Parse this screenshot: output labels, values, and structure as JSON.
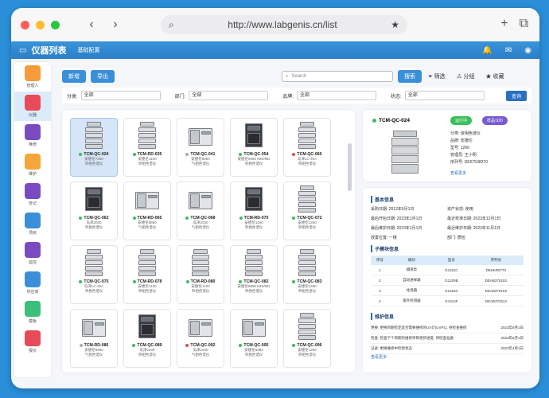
{
  "browser": {
    "url": "http://www.labgenis.cn/list"
  },
  "app": {
    "title": "仪器列表",
    "subtitle": "基础配置"
  },
  "sidebar": [
    {
      "label": "管理人",
      "color": "#f59b3a"
    },
    {
      "label": "仪器",
      "color": "#e84a5a"
    },
    {
      "label": "维修",
      "color": "#7a4bbf"
    },
    {
      "label": "维护",
      "color": "#f5a53a"
    },
    {
      "label": "管记",
      "color": "#7a4bbf"
    },
    {
      "label": "项目",
      "color": "#3b8fd8"
    },
    {
      "label": "监控",
      "color": "#7a4bbf"
    },
    {
      "label": "供应商",
      "color": "#3b8fd8"
    },
    {
      "label": "模板",
      "color": "#3bbf7a"
    },
    {
      "label": "报价",
      "color": "#e84a5a"
    }
  ],
  "toolbar": {
    "new": "新增",
    "export": "导出",
    "search_placeholder": "Search",
    "search": "搜索",
    "filter": "筛选",
    "group": "分组",
    "favorite": "收藏"
  },
  "filters": [
    {
      "label": "分类:",
      "value": "全部"
    },
    {
      "label": "部门:",
      "value": "全部"
    },
    {
      "label": "品牌:",
      "value": "全部"
    },
    {
      "label": "状态:",
      "value": "全部"
    }
  ],
  "filters_query": "查询",
  "cards": [
    {
      "id": "TCM-QC-024",
      "l1": "安捷伦7260",
      "l2": "单相色谱仪",
      "status": "#3bbf5a",
      "type": "hplc"
    },
    {
      "id": "TCM-RD-035",
      "l1": "安捷伦1100",
      "l2": "单相色谱仪",
      "status": "#3bbf5a",
      "type": "hplc"
    },
    {
      "id": "TCM-QC-041",
      "l1": "安捷伦8860",
      "l2": "气相色谱仪",
      "status": "#aaaaaa",
      "type": "gc"
    },
    {
      "id": "TCM-QC-054",
      "l1": "安捷伦6890 IMS/MD",
      "l2": "单相色谱仪",
      "status": "#3bbf5a",
      "type": "dark"
    },
    {
      "id": "TCM-QC-060",
      "l1": "岛津LC-20A",
      "l2": "单相色谱仪",
      "status": "#e84a4a",
      "type": "hplc"
    },
    {
      "id": "TCM-QC-062",
      "l1": "岛津2030",
      "l2": "单相色谱仪",
      "status": "#3bbf5a",
      "type": "dark"
    },
    {
      "id": "TCM-RD-065",
      "l1": "安捷伦8860",
      "l2": "气相色谱仪",
      "status": "#3bbf5a",
      "type": "gc"
    },
    {
      "id": "TCM-QC-068",
      "l1": "岛津2030",
      "l2": "气相色谱仪",
      "status": "#3bbf5a",
      "type": "gc"
    },
    {
      "id": "TCM-RD-070",
      "l1": "安捷伦1100",
      "l2": "单相色谱仪",
      "status": "#3bbf5a",
      "type": "dark"
    },
    {
      "id": "TCM-QC-072",
      "l1": "安捷伦1260",
      "l2": "单相色谱仪",
      "status": "#3bbf5a",
      "type": "hplc"
    },
    {
      "id": "TCM-QC-075",
      "l1": "岛津LC-20A",
      "l2": "单相色谱仪",
      "status": "#3bbf5a",
      "type": "hplc"
    },
    {
      "id": "TCM-RD-078",
      "l1": "安捷伦1100",
      "l2": "单相色谱仪",
      "status": "#3bbf5a",
      "type": "hplc"
    },
    {
      "id": "TCM-RD-080",
      "l1": "安捷伦1100",
      "l2": "单相色谱仪",
      "status": "#3bbf5a",
      "type": "hplc"
    },
    {
      "id": "TCM-QC-082",
      "l1": "安捷伦6890 IMS/MD",
      "l2": "单相色谱仪",
      "status": "#3bbf5a",
      "type": "hplc"
    },
    {
      "id": "TCM-QC-083",
      "l1": "安捷伦1260",
      "l2": "单相色谱仪",
      "status": "#3bbf5a",
      "type": "hplc"
    },
    {
      "id": "TCM-RD-086",
      "l1": "安捷伦8860",
      "l2": "气相色谱仪",
      "status": "#aaaaaa",
      "type": "gc"
    },
    {
      "id": "TCM-QC-089",
      "l1": "岛津2030",
      "l2": "单相色谱仪",
      "status": "#3bbf5a",
      "type": "dark"
    },
    {
      "id": "TCM-QC-092",
      "l1": "岛津2030",
      "l2": "气相色谱仪",
      "status": "#e84a4a",
      "type": "gc"
    },
    {
      "id": "TCM-QC-095",
      "l1": "安捷伦6890",
      "l2": "单相色谱仪",
      "status": "#3bbf5a",
      "type": "gc"
    },
    {
      "id": "TCM-QC-096",
      "l1": "安捷伦1260",
      "l2": "单相色谱仪",
      "status": "#3bbf5a",
      "type": "hplc"
    }
  ],
  "detail": {
    "id": "TCM-QC-024",
    "status": "运行中",
    "tag": "样品:020",
    "lines": [
      "分类: 液相色谱仪",
      "品牌: 安捷伦",
      "型号: 1260",
      "管理员: 王小明",
      "序列号: DE57538270"
    ],
    "more": "查看更多"
  },
  "basic": {
    "title": "基本信息",
    "items": [
      "采购日期: 2012年6月1日",
      "资产状态: 使用",
      "最后开始日期: 2023年1月1日",
      "最近校准日期: 2023年12月1日",
      "最后维护日期: 2023年1月1日",
      "最近维护日期: 2023年11月1日",
      "放置位置: 一楼",
      "部门: 质检"
    ]
  },
  "modules": {
    "title": "子模块信息",
    "headers": [
      "序号",
      "模块",
      "型号",
      "序列号"
    ],
    "rows": [
      [
        "1",
        "输液泵",
        "G1311C",
        "DEKKR0770"
      ],
      [
        "2",
        "自动进样器",
        "G1329B",
        "DEAB370102"
      ],
      [
        "3",
        "柱温箱",
        "G1316C",
        "DEAB370102"
      ],
      [
        "4",
        "紫外检测器",
        "G1314F",
        "DEAB370113"
      ]
    ]
  },
  "maintenance": {
    "title": "维护信息",
    "rows": [
      {
        "text": "更换: 更换到期检定是否需要维修的UV灯(UVP1), 待检查维修",
        "date": "2023年6月1日"
      },
      {
        "text": "检查: 检查下个周期的维修项目更新进度, 待检查准备",
        "date": "2023年5月1日"
      },
      {
        "text": "记录: 更换维修中检修状态",
        "date": "2023年4月1日"
      }
    ],
    "more": "查看更多"
  }
}
